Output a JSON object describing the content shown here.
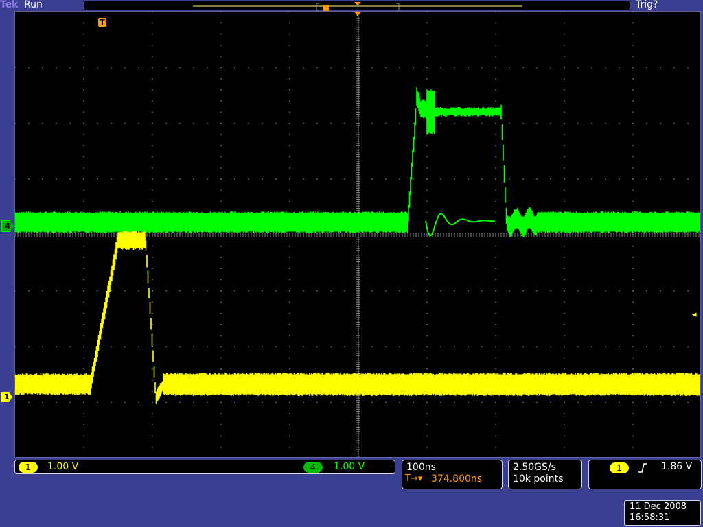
{
  "header": {
    "brand": "Tek",
    "run_state": "Run",
    "trigger_status": "Trig?"
  },
  "markers": {
    "trigger_position": "T",
    "ch4_ground": "4",
    "ch1_ground": "1",
    "trigger_level": "◂"
  },
  "channels": {
    "ch1": {
      "number": "1",
      "scale": "1.00 V",
      "color": "#ffff00"
    },
    "ch4": {
      "number": "4",
      "scale": "1.00 V",
      "color": "#00ff00"
    }
  },
  "timebase": {
    "scale": "100ns",
    "delay_icon": "T→▾",
    "delay": "374.800ns"
  },
  "acquisition": {
    "sample_rate": "2.50GS/s",
    "record_length": "10k points"
  },
  "trigger": {
    "source": "1",
    "slope_icon": "rising-edge-icon",
    "level": "1.86 V"
  },
  "datetime": {
    "date": "11 Dec 2008",
    "time": "16:58:31"
  },
  "colors": {
    "background": "#3a3f91",
    "graticule": "#8a8a8a",
    "ch1": "#ffff00",
    "ch4": "#00ff00",
    "accent": "#ff9900"
  }
}
